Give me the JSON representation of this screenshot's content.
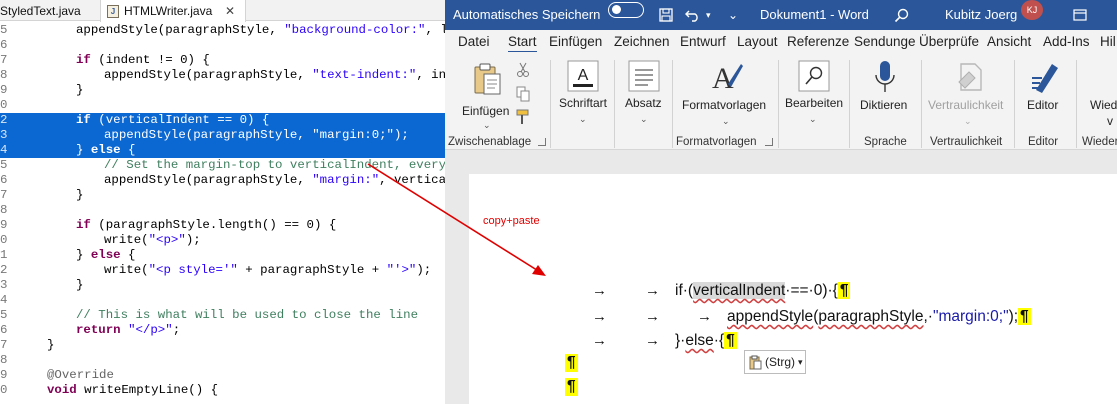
{
  "eclipse": {
    "tabs": [
      {
        "label": "StyledText.java"
      },
      {
        "label": "HTMLWriter.java",
        "close": "✕"
      }
    ],
    "lines": [
      {
        "num": "5",
        "text": "appendStyle(paragraphStyle, \"background-color:\", line",
        "indent": 1
      },
      {
        "num": "6",
        "text": "",
        "indent": 0
      },
      {
        "num": "7",
        "text": "if (indent != 0) {",
        "indent": 1
      },
      {
        "num": "8",
        "text": "appendStyle(paragraphStyle, \"text-indent:\", inden",
        "indent": 2
      },
      {
        "num": "9",
        "text": "}",
        "indent": 1
      },
      {
        "num": "0",
        "text": "",
        "indent": 0
      },
      {
        "num": "2",
        "text": "if (verticalIndent == 0) {",
        "indent": 1,
        "selected": true
      },
      {
        "num": "3",
        "text": "appendStyle(paragraphStyle, \"margin:0;\");",
        "indent": 2,
        "selected": true
      },
      {
        "num": "4",
        "text": "} else {",
        "indent": 1,
        "selected": true
      },
      {
        "num": "5",
        "text": "// Set the margin-top to verticalIndent, everythi",
        "indent": 2
      },
      {
        "num": "6",
        "text": "appendStyle(paragraphStyle, \"margin:\", verticalIn",
        "indent": 2
      },
      {
        "num": "7",
        "text": "}",
        "indent": 1
      },
      {
        "num": "8",
        "text": "",
        "indent": 0
      },
      {
        "num": "9",
        "text": "if (paragraphStyle.length() == 0) {",
        "indent": 1
      },
      {
        "num": "0",
        "text": "write(\"<p>\");",
        "indent": 2
      },
      {
        "num": "1",
        "text": "} else {",
        "indent": 1
      },
      {
        "num": "2",
        "text": "write(\"<p style='\" + paragraphStyle + \"'>\");",
        "indent": 2
      },
      {
        "num": "3",
        "text": "}",
        "indent": 1
      },
      {
        "num": "4",
        "text": "",
        "indent": 0
      },
      {
        "num": "5",
        "text": "// This is what will be used to close the line",
        "indent": 1
      },
      {
        "num": "6",
        "text": "return \"</p>\";",
        "indent": 1
      },
      {
        "num": "7",
        "text": "}",
        "indent": 0
      },
      {
        "num": "8",
        "text": "",
        "indent": 0
      },
      {
        "num": "9",
        "text": "@Override",
        "indent": 0
      },
      {
        "num": "0",
        "text": "void writeEmptyLine() {",
        "indent": 0
      }
    ]
  },
  "word": {
    "autosave": "Automatisches Speichern",
    "doc_title": "Dokument1  -  Word",
    "user": "Kubitz Joerg",
    "initials": "KJ",
    "menu": [
      "Datei",
      "Start",
      "Einfügen",
      "Zeichnen",
      "Entwurf",
      "Layout",
      "Referenze",
      "Sendunge",
      "Überprüfe",
      "Ansicht",
      "Add-Ins",
      "Hil"
    ],
    "ribbon": {
      "einfuegen": "Einfügen",
      "schriftart": "Schriftart",
      "absatz": "Absatz",
      "formatvorlagen": "Formatvorlagen",
      "bearbeiten": "Bearbeiten",
      "diktieren": "Diktieren",
      "vertraulichkeit": "Vertraulichkeit",
      "editor": "Editor",
      "wiede": "Wiede",
      "wiede2": "v"
    },
    "groups": {
      "zwischenablage": "Zwischenablage",
      "formatvorlagen": "Formatvorlagen",
      "sprache": "Sprache",
      "vertraulichkeit": "Vertraulichkeit",
      "editor": "Editor",
      "wiederv": "Wiederv"
    },
    "doc": {
      "line1_a": "if·(",
      "line1_b": "verticalIndent",
      "line1_c": "·==·0)·{",
      "line2_a": "appendStyle",
      "line2_b": "(",
      "line2_c": "paragraphStyle",
      "line2_d": ",·",
      "line2_e": "\"margin:0;\"",
      "line2_f": ");",
      "line3_a": "}·",
      "line3_b": "else",
      "line3_c": "·{",
      "pilcrow": "¶",
      "tab": "→",
      "paste_label": "(Strg)",
      "paste_caret": "▾"
    }
  },
  "annotation": {
    "label": "copy+paste"
  },
  "colors": {
    "selection": "#0b67d2",
    "word_blue": "#2b579a",
    "arrow": "#e00000",
    "highlight": "#ffff00"
  }
}
